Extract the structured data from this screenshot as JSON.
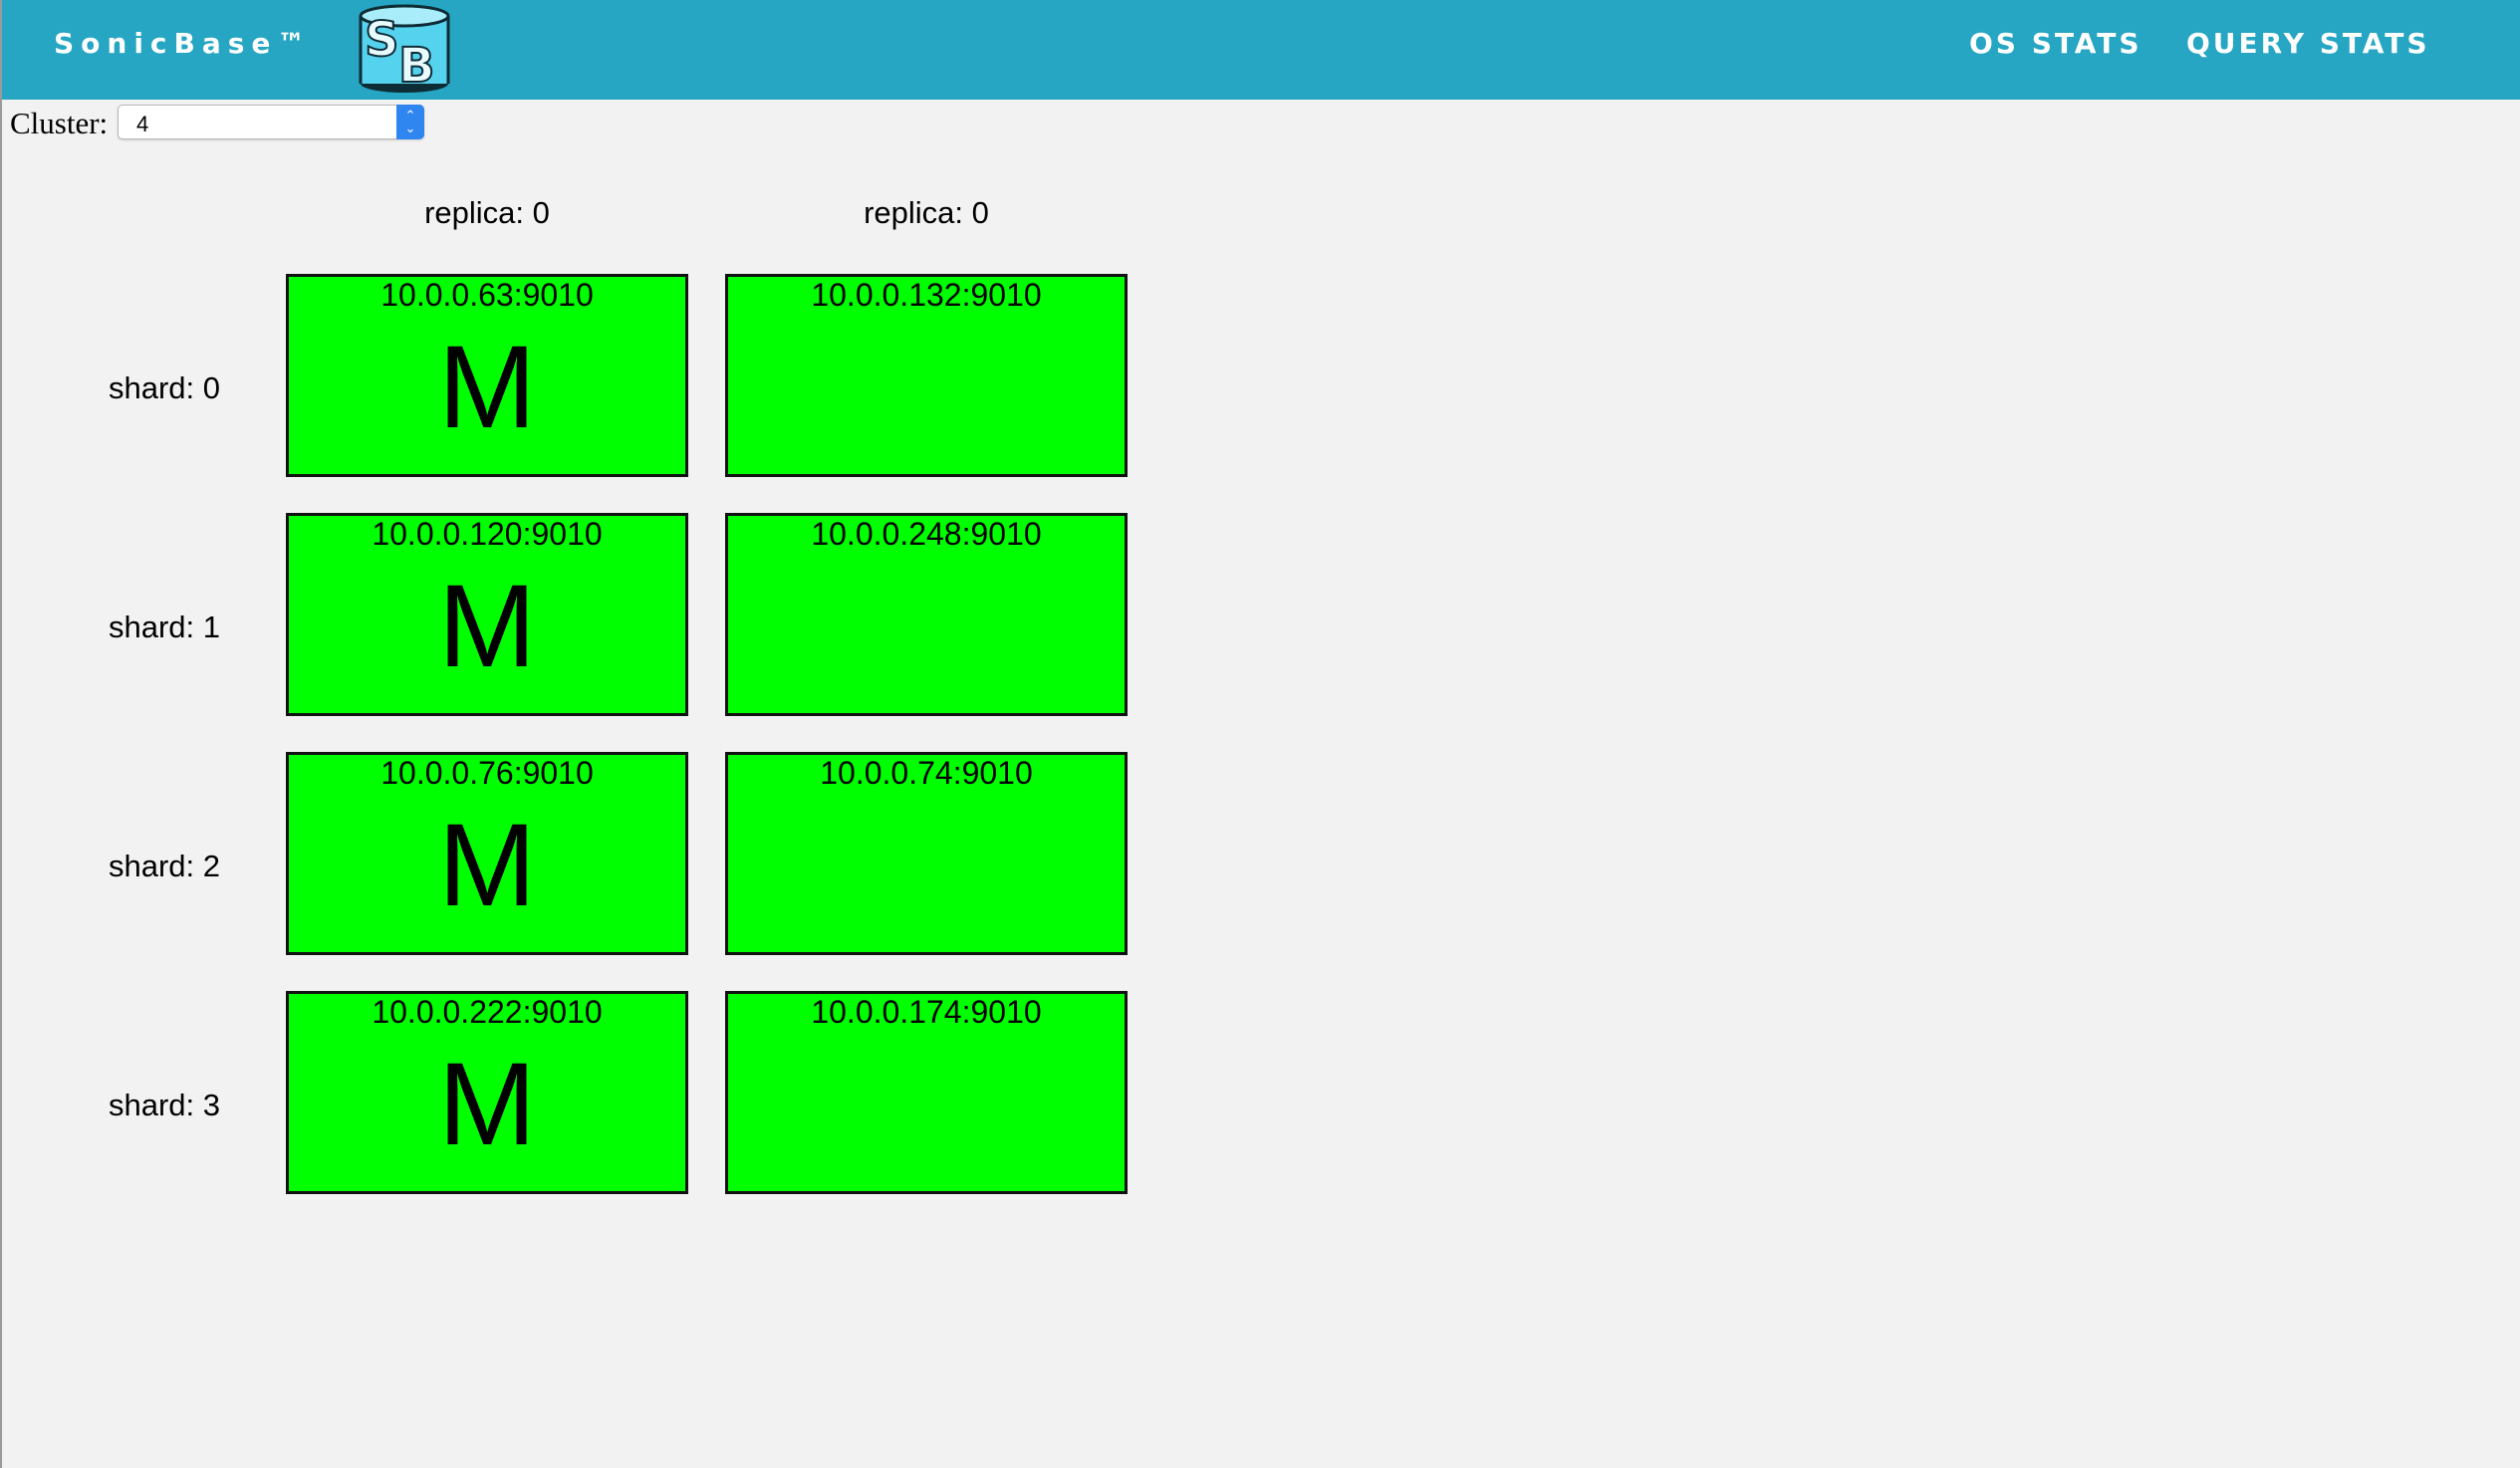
{
  "header": {
    "brand": "SonicBase™",
    "nav": [
      {
        "label": "OS STATS"
      },
      {
        "label": "QUERY STATS"
      }
    ]
  },
  "cluster": {
    "label": "Cluster:",
    "selected": "4"
  },
  "replica_headers": [
    "replica: 0",
    "replica: 0"
  ],
  "shards": [
    {
      "label": "shard: 0",
      "servers": [
        {
          "address": "10.0.0.63:9010",
          "role": "M"
        },
        {
          "address": "10.0.0.132:9010",
          "role": ""
        }
      ]
    },
    {
      "label": "shard: 1",
      "servers": [
        {
          "address": "10.0.0.120:9010",
          "role": "M"
        },
        {
          "address": "10.0.0.248:9010",
          "role": ""
        }
      ]
    },
    {
      "label": "shard: 2",
      "servers": [
        {
          "address": "10.0.0.76:9010",
          "role": "M"
        },
        {
          "address": "10.0.0.74:9010",
          "role": ""
        }
      ]
    },
    {
      "label": "shard: 3",
      "servers": [
        {
          "address": "10.0.0.222:9010",
          "role": "M"
        },
        {
          "address": "10.0.0.174:9010",
          "role": ""
        }
      ]
    }
  ],
  "colors": {
    "header_bg": "#26a6c3",
    "server_ok": "#00ff00",
    "page_bg": "#f2f2f2"
  }
}
